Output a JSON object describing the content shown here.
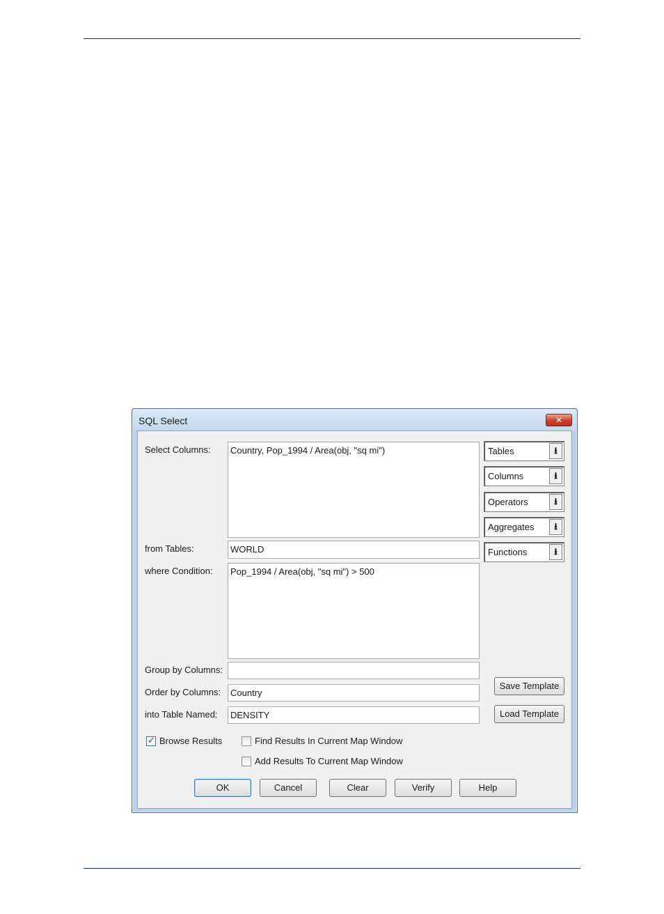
{
  "dialog": {
    "title": "SQL Select",
    "close_icon": "close-icon"
  },
  "labels": {
    "select_columns": "Select Columns:",
    "from_tables": "from Tables:",
    "where_condition": "where Condition:",
    "group_by": "Group by Columns:",
    "order_by": "Order by Columns:",
    "into_table": "into Table Named:"
  },
  "fields": {
    "select_columns": "Country, Pop_1994 / Area(obj, \"sq mi\")",
    "from_tables": "WORLD",
    "where_condition": "Pop_1994 / Area(obj, \"sq mi\") > 500",
    "group_by": "",
    "order_by": "Country",
    "into_table": "DENSITY"
  },
  "dropdowns": {
    "tables": "Tables",
    "columns": "Columns",
    "operators": "Operators",
    "aggregates": "Aggregates",
    "functions": "Functions",
    "arrow_glyph": "⭳"
  },
  "templates": {
    "save": "Save Template",
    "load": "Load Template"
  },
  "options": {
    "browse_results": {
      "label": "Browse Results",
      "checked": true
    },
    "find_results": {
      "label": "Find Results In Current Map Window",
      "checked": false
    },
    "add_results": {
      "label": "Add Results To Current Map Window",
      "checked": false
    },
    "check_glyph": "✓"
  },
  "buttons": {
    "ok": "OK",
    "cancel": "Cancel",
    "clear": "Clear",
    "verify": "Verify",
    "help": "Help"
  }
}
